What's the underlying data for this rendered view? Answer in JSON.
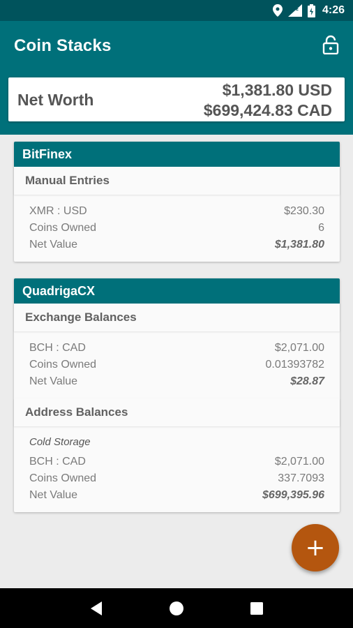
{
  "status_bar": {
    "icons": [
      "location-icon",
      "signal-icon",
      "battery-icon"
    ],
    "time": "4:26"
  },
  "app_bar": {
    "title": "Coin Stacks",
    "lock_icon": "lock-icon"
  },
  "net_worth": {
    "label": "Net Worth",
    "usd": "$1,381.80 USD",
    "cad": "$699,424.83 CAD"
  },
  "exchanges": [
    {
      "name": "BitFinex",
      "sections": [
        {
          "title": "Manual Entries",
          "entries": [
            {
              "rows": [
                {
                  "label": "XMR : USD",
                  "value": "$230.30"
                },
                {
                  "label": "Coins Owned",
                  "value": "6"
                },
                {
                  "label": "Net Value",
                  "value": "$1,381.80"
                }
              ]
            }
          ]
        }
      ]
    },
    {
      "name": "QuadrigaCX",
      "sections": [
        {
          "title": "Exchange Balances",
          "entries": [
            {
              "rows": [
                {
                  "label": "BCH : CAD",
                  "value": "$2,071.00"
                },
                {
                  "label": "Coins Owned",
                  "value": "0.01393782"
                },
                {
                  "label": "Net Value",
                  "value": "$28.87"
                }
              ]
            }
          ]
        },
        {
          "title": "Address Balances",
          "entries": [
            {
              "note": "Cold Storage",
              "rows": [
                {
                  "label": "BCH : CAD",
                  "value": "$2,071.00"
                },
                {
                  "label": "Coins Owned",
                  "value": "337.7093"
                },
                {
                  "label": "Net Value",
                  "value": "$699,395.96"
                }
              ]
            }
          ]
        }
      ]
    }
  ],
  "fab": {
    "icon": "plus-icon",
    "symbol": "+"
  },
  "nav_bar": [
    "back-icon",
    "home-icon",
    "recents-icon"
  ],
  "colors": {
    "primary": "#00707a",
    "primary_dark": "#00535c",
    "accent": "#b4560f",
    "background": "#ececec"
  }
}
